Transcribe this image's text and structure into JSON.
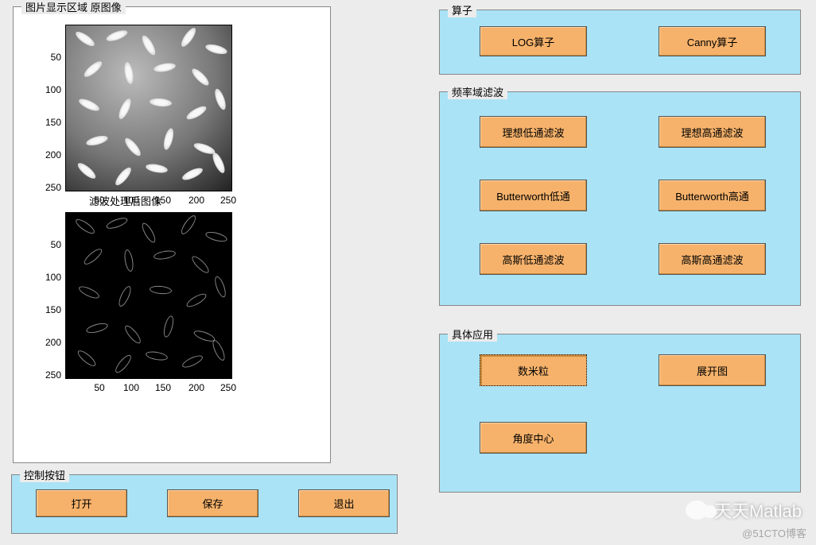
{
  "panels": {
    "image": {
      "legend": "图片显示区域    原图像"
    },
    "control": {
      "legend": "控制按钮"
    },
    "operator": {
      "legend": "算子"
    },
    "freq": {
      "legend": "频率域滤波"
    },
    "app": {
      "legend": "具体应用"
    }
  },
  "plots": {
    "top": {
      "yticks": [
        "50",
        "100",
        "150",
        "200",
        "250"
      ],
      "xtitle": "滤波处理后图像",
      "xticks": [
        "50",
        "100",
        "150",
        "200",
        "250"
      ]
    },
    "bottom": {
      "yticks": [
        "50",
        "100",
        "150",
        "200",
        "250"
      ],
      "xticks": [
        "50",
        "100",
        "150",
        "200",
        "250"
      ]
    }
  },
  "buttons": {
    "open": "打开",
    "save": "保存",
    "exit": "退出",
    "log": "LOG算子",
    "canny": "Canny算子",
    "ideal_lp": "理想低通滤波",
    "ideal_hp": "理想高通滤波",
    "butter_lp": "Butterworth低通",
    "butter_hp": "Butterworth高通",
    "gauss_lp": "高斯低通滤波",
    "gauss_hp": "高斯高通滤波",
    "count_rice": "数米粒",
    "spread": "展开图",
    "angle_center": "角度中心"
  },
  "watermark": {
    "wechat": "天天Matlab",
    "cto": "@51CTO博客"
  }
}
